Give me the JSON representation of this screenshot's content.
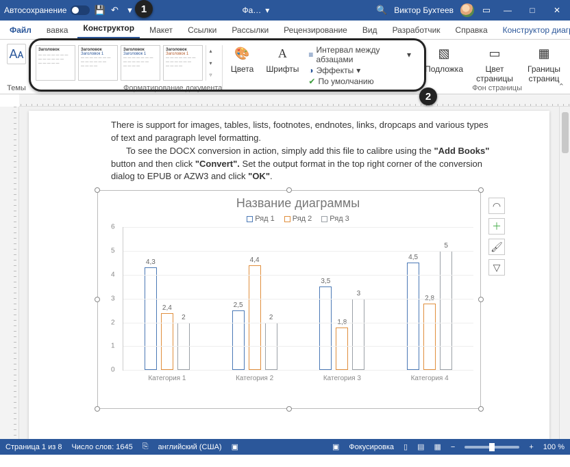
{
  "titlebar": {
    "autosave_label": "Автосохранение",
    "doc_title": "Фа…",
    "user_name": "Виктор Бухтеев"
  },
  "ribbon": {
    "tabs": {
      "file": "Файл",
      "vavka_partial": "вавка",
      "konstruktor": "Конструктор",
      "maket": "Макет",
      "ssylki": "Ссылки",
      "rassylki": "Рассылки",
      "recenz": "Рецензирование",
      "vid": "Вид",
      "razrabotchik": "Разработчик",
      "spravka": "Справка",
      "chart_design": "Конструктор диаграмм"
    },
    "themes_label": "Темы",
    "style_card_heading": "Заголовок",
    "style_card_h1": "Заголовок 1",
    "colors_label": "Цвета",
    "fonts_label": "Шрифты",
    "paragraph_spacing": "Интервал между абзацами",
    "effects": "Эффекты",
    "set_default": "По умолчанию",
    "watermark": "Подложка",
    "page_color": "Цвет страницы",
    "page_borders": "Границы страниц",
    "page_background_section": "Фон страницы",
    "doc_formatting_section": "Форматирование документа"
  },
  "callouts": {
    "one": "1",
    "two": "2"
  },
  "document": {
    "para1": "There is support for images, tables, lists, footnotes, endnotes, links, dropcaps and various types of text and paragraph level formatting.",
    "para2_a": "To see the DOCX conversion in action, simply add this file to calibre using the ",
    "para2_b": "\"Add Books\"",
    "para2_c": " button and then click ",
    "para2_d": "\"Convert\".",
    "para2_e": "  Set the output format in the top right corner of the conversion dialog to EPUB or AZW3 and click ",
    "para2_f": "\"OK\"",
    "para2_g": "."
  },
  "chart_data": {
    "type": "bar",
    "title": "Название диаграммы",
    "categories": [
      "Категория 1",
      "Категория 2",
      "Категория 3",
      "Категория 4"
    ],
    "series": [
      {
        "name": "Ряд 1",
        "color": "#4a78b5",
        "values": [
          4.3,
          2.5,
          3.5,
          4.5
        ]
      },
      {
        "name": "Ряд 2",
        "color": "#e08e3c",
        "values": [
          2.4,
          4.4,
          1.8,
          2.8
        ]
      },
      {
        "name": "Ряд 3",
        "color": "#9aa0a6",
        "values": [
          2,
          2,
          3,
          5
        ]
      }
    ],
    "ylim": [
      0,
      6
    ],
    "yticks": [
      0,
      1,
      2,
      3,
      4,
      5,
      6
    ]
  },
  "statusbar": {
    "page": "Страница 1 из 8",
    "words": "Число слов: 1645",
    "lang": "английский (США)",
    "focus": "Фокусировка",
    "zoom": "100 %"
  }
}
